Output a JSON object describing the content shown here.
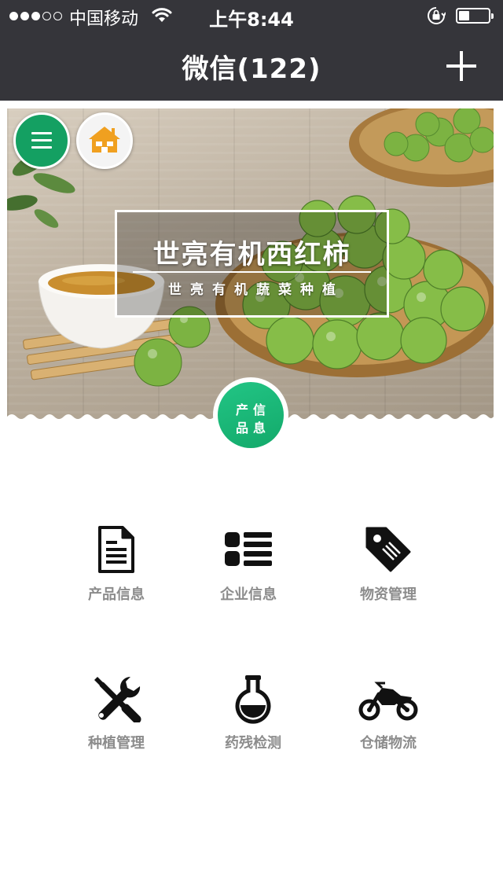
{
  "status_bar": {
    "carrier": "中国移动",
    "time": "上午8:44",
    "signal_dots_filled": 3,
    "signal_dots_total": 5,
    "battery_level": 0.35
  },
  "nav": {
    "title": "微信(122)",
    "add_icon": "plus-icon"
  },
  "banner": {
    "menu_icon": "hamburger-icon",
    "home_icon": "house-icon",
    "title": "世亮有机西红柿",
    "subtitle": "世亮有机蔬菜种植",
    "badge_line1": "产信",
    "badge_line2": "品息"
  },
  "menu": {
    "items": [
      {
        "label": "产品信息",
        "icon": "document-icon"
      },
      {
        "label": "企业信息",
        "icon": "list-icon"
      },
      {
        "label": "物资管理",
        "icon": "tag-icon"
      },
      {
        "label": "种植管理",
        "icon": "tools-icon"
      },
      {
        "label": "药残检测",
        "icon": "flask-icon"
      },
      {
        "label": "仓储物流",
        "icon": "motorcycle-icon"
      }
    ]
  },
  "colors": {
    "nav_bg": "#35353a",
    "accent_green": "#14a062",
    "home_orange": "#f0a020",
    "label_gray": "#8c8c8c"
  }
}
